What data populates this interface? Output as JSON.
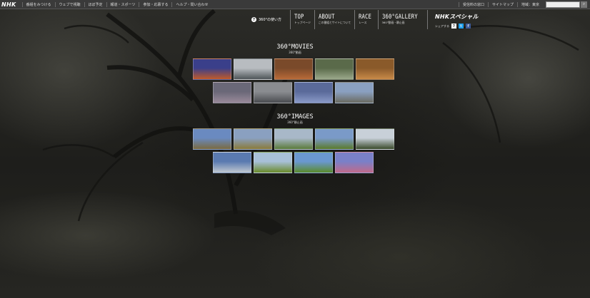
{
  "topbar": {
    "logo": "NHK",
    "nav": [
      "番組をみつける",
      "ウェブで視聴",
      "ほぼ予定",
      "報道・スポーツ",
      "参加・応募する",
      "ヘルプ・問い合わせ"
    ],
    "right_nav": [
      "受信料の窓口",
      "サイトマップ",
      "地域：東京"
    ],
    "search_placeholder": ""
  },
  "header": {
    "how_to_label": "360°の使い方",
    "nav": [
      {
        "main": "TOP",
        "sub": "トップページ"
      },
      {
        "main": "ABOUT",
        "sub": "この番組とサイトについて"
      },
      {
        "main": "RACE",
        "sub": "レース"
      },
      {
        "main": "360°GALLERY",
        "sub": "360°動画・静止画"
      }
    ],
    "brand_logo": "NHKスペシャル",
    "share_label": "シェアする"
  },
  "movies": {
    "title": "360°MOVIES",
    "subtitle": "360°動画",
    "thumbs": [
      {
        "name": "movie-1",
        "c1": "#3a3f8a",
        "c2": "#c05a2a"
      },
      {
        "name": "movie-2",
        "c1": "#b8bcc0",
        "c2": "#4e5558"
      },
      {
        "name": "movie-3",
        "c1": "#7a4a2a",
        "c2": "#b86a38"
      },
      {
        "name": "movie-4",
        "c1": "#5a6a4a",
        "c2": "#9aa88a"
      },
      {
        "name": "movie-5",
        "c1": "#8a5a2a",
        "c2": "#c88a48"
      },
      {
        "name": "movie-6",
        "c1": "#6a6878",
        "c2": "#9a8a9a"
      },
      {
        "name": "movie-7",
        "c1": "#8a8c90",
        "c2": "#4a4c50"
      },
      {
        "name": "movie-8",
        "c1": "#5a6a9a",
        "c2": "#8a9ac8"
      },
      {
        "name": "movie-9",
        "c1": "#8aa0c0",
        "c2": "#6a6a60"
      }
    ]
  },
  "images": {
    "title": "360°IMAGES",
    "subtitle": "360°静止画",
    "thumbs": [
      {
        "name": "image-1",
        "c1": "#6a8ac0",
        "c2": "#7a6a40"
      },
      {
        "name": "image-2",
        "c1": "#8aa0c0",
        "c2": "#8a7a3a"
      },
      {
        "name": "image-3",
        "c1": "#a8b8c8",
        "c2": "#5a7a3a"
      },
      {
        "name": "image-4",
        "c1": "#7a9ac8",
        "c2": "#5a7a2a"
      },
      {
        "name": "image-5",
        "c1": "#c8d0d8",
        "c2": "#3a4a2a"
      },
      {
        "name": "image-6",
        "c1": "#5a7ab0",
        "c2": "#c0c8d0"
      },
      {
        "name": "image-7",
        "c1": "#a8c0d8",
        "c2": "#6a8a2a"
      },
      {
        "name": "image-8",
        "c1": "#6a98d0",
        "c2": "#5a8a2a"
      },
      {
        "name": "image-9",
        "c1": "#7a80c8",
        "c2": "#c06a8a"
      }
    ]
  },
  "colors": {
    "twitter": "#1da1f2",
    "facebook": "#3b5998"
  }
}
